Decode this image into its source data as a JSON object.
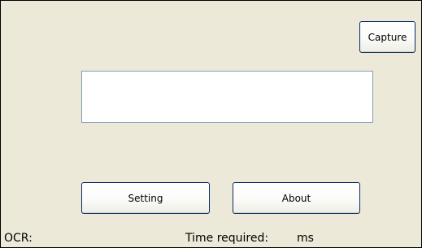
{
  "buttons": {
    "capture": "Capture",
    "setting": "Setting",
    "about": "About"
  },
  "result_box": {
    "value": ""
  },
  "status": {
    "ocr_label": "OCR:",
    "time_label": "Time required:",
    "time_unit": "ms"
  },
  "colors": {
    "window_background": "#ece9d8",
    "button_border": "#0a2a66",
    "textbox_border": "#7f9db9"
  }
}
